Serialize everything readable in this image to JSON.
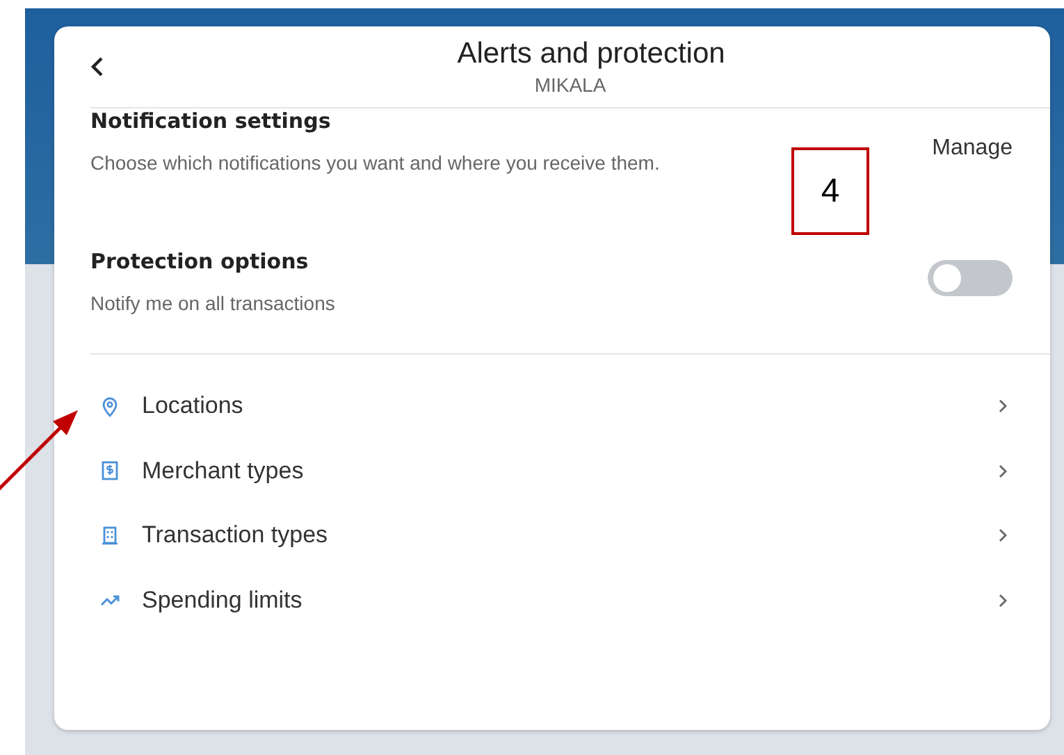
{
  "header": {
    "title": "Alerts and protection",
    "subtitle": "MIKALA"
  },
  "sections": [
    {
      "kind": "link",
      "title": "Notification settings",
      "description": "Choose which notifications you want and where you receive them.",
      "action": "Manage"
    },
    {
      "kind": "toggle",
      "title": "Protection options",
      "description": "Notify me on all transactions",
      "on": false
    }
  ],
  "items": [
    {
      "kind": "location",
      "label": "Locations"
    },
    {
      "kind": "merchant",
      "label": "Merchant types"
    },
    {
      "kind": "transaction",
      "label": "Transaction types"
    },
    {
      "kind": "limit",
      "label": "Spending limits"
    }
  ],
  "annotation": {
    "label": "4"
  }
}
